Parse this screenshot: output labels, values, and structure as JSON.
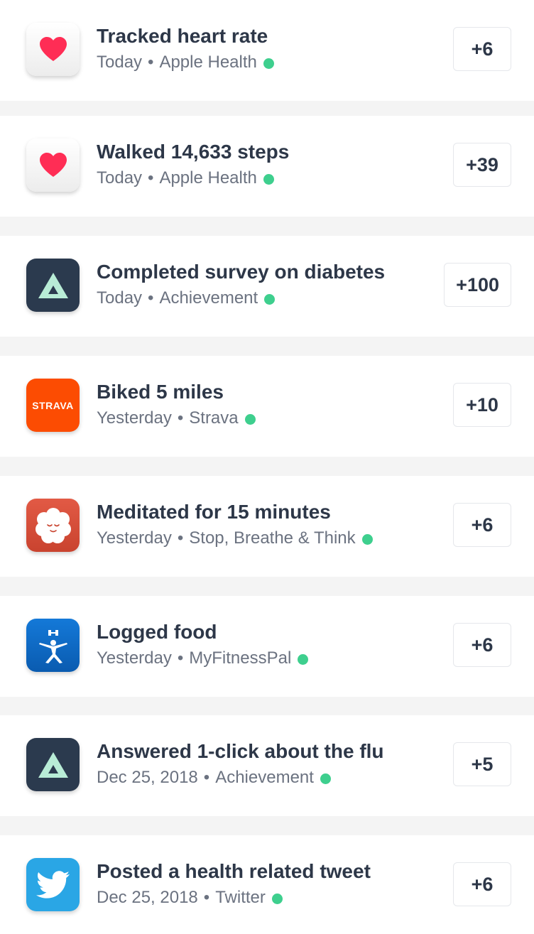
{
  "colors": {
    "background": "#f4f4f4",
    "card": "#ffffff",
    "title_text": "#2d3748",
    "meta_text": "#6b7280",
    "sync_dot": "#3ecf8e",
    "points_border": "#e5e7eb"
  },
  "activities": [
    {
      "title": "Tracked heart rate",
      "when": "Today",
      "source": "Apple Health",
      "points": "+6",
      "icon": "apple-health-icon"
    },
    {
      "title": "Walked 14,633 steps",
      "when": "Today",
      "source": "Apple Health",
      "points": "+39",
      "icon": "apple-health-icon"
    },
    {
      "title": "Completed survey on diabetes",
      "when": "Today",
      "source": "Achievement",
      "points": "+100",
      "icon": "achievement-icon"
    },
    {
      "title": "Biked 5 miles",
      "when": "Yesterday",
      "source": "Strava",
      "points": "+10",
      "icon": "strava-icon"
    },
    {
      "title": "Meditated for 15 minutes",
      "when": "Yesterday",
      "source": "Stop, Breathe & Think",
      "points": "+6",
      "icon": "stop-breathe-think-icon"
    },
    {
      "title": "Logged food",
      "when": "Yesterday",
      "source": "MyFitnessPal",
      "points": "+6",
      "icon": "myfitnesspal-icon"
    },
    {
      "title": "Answered 1-click about the flu",
      "when": "Dec 25, 2018",
      "source": "Achievement",
      "points": "+5",
      "icon": "achievement-icon"
    },
    {
      "title": "Posted a health related tweet",
      "when": "Dec 25, 2018",
      "source": "Twitter",
      "points": "+6",
      "icon": "twitter-icon"
    }
  ],
  "strava_wordmark": "STRAVA"
}
